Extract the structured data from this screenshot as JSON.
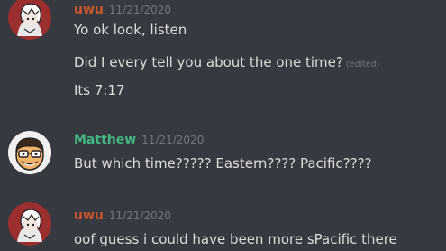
{
  "groups": [
    {
      "username": "uwu",
      "username_color": "#c9562d",
      "timestamp": "11/21/2020",
      "avatar": "anime-character-avatar",
      "messages": [
        {
          "text": "Yo ok look, listen",
          "edited": ""
        },
        {
          "text": "Did I every tell you about the one time?",
          "edited": "(edited)"
        },
        {
          "text": "Its 7:17",
          "edited": ""
        }
      ]
    },
    {
      "username": "Matthew",
      "username_color": "#43b581",
      "timestamp": "11/21/2020",
      "avatar": "cartoon-face-avatar",
      "messages": [
        {
          "text": "But which time????? Eastern???? Pacific????",
          "edited": ""
        }
      ]
    },
    {
      "username": "uwu",
      "username_color": "#c9562d",
      "timestamp": "11/21/2020",
      "avatar": "anime-character-avatar",
      "messages": [
        {
          "text": "oof guess i could have been more sPacific there",
          "edited": ""
        }
      ]
    }
  ]
}
